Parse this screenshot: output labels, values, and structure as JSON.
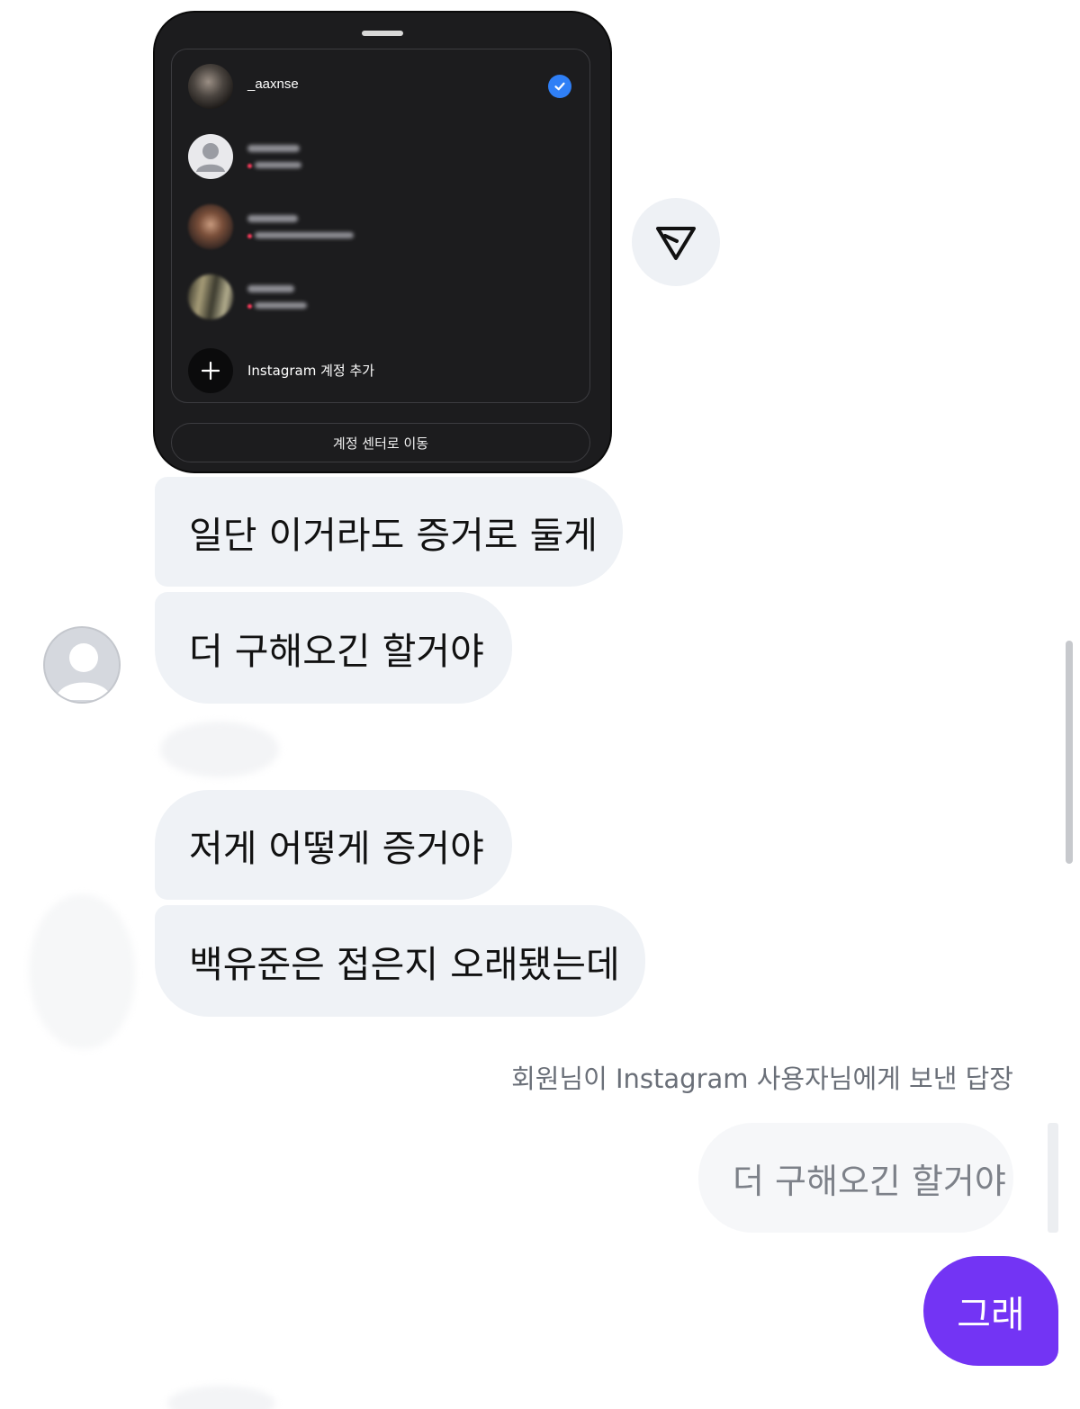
{
  "shared_image": {
    "accounts": [
      {
        "username": "_aaxnse",
        "selected": true,
        "avatar": "photo-avatar"
      },
      {
        "username": "",
        "selected": false,
        "avatar": "default-avatar"
      },
      {
        "username": "",
        "selected": false,
        "avatar": "photo-avatar"
      },
      {
        "username": "",
        "selected": false,
        "avatar": "photo-avatar"
      }
    ],
    "add_account_label": "Instagram 계정 추가",
    "account_center_button": "계정 센터로 이동"
  },
  "messages": {
    "received": [
      "일단 이거라도 증거로 둘게",
      "더 구해오긴 할거야",
      "저게 어떻게 증거야",
      "백유준은 접은지 오래됐는데"
    ],
    "reply_caption": "회원님이 Instagram 사용자님에게 보낸 답장",
    "quoted_message": "더 구해오긴 할거야",
    "sent": "그래"
  },
  "colors": {
    "sent_bubble": "#7334f4",
    "received_bubble": "#eff2f6",
    "check_badge": "#2f7ff6",
    "card_background": "#1c1c1e"
  }
}
